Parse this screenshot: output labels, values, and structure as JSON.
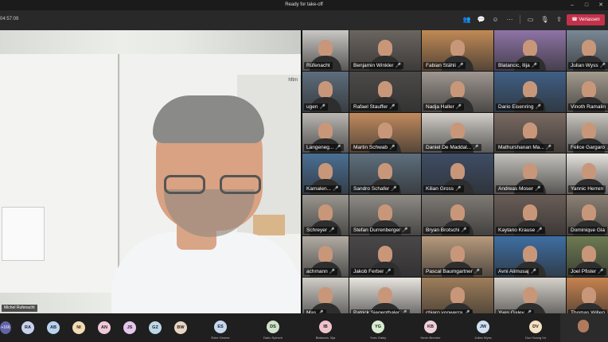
{
  "window": {
    "title": "Ready for take-off",
    "controls": [
      "–",
      "□",
      "✕"
    ]
  },
  "toolbar": {
    "timer": "04:57:09",
    "icons": [
      "people-icon",
      "chat-icon",
      "reactions-icon",
      "more-icon",
      "camera-icon",
      "mic-icon",
      "share-icon"
    ],
    "leave_label": "Verlassen"
  },
  "speaker": {
    "name": "Michel Rufenacht",
    "poster_logo": "hftm"
  },
  "participants": [
    {
      "name": "Rüfenacht",
      "bg": "#c9c7c4",
      "mic": false
    },
    {
      "name": "Benjamin Winkler",
      "bg": "#6b6560",
      "mic": true
    },
    {
      "name": "Fabian Stähli",
      "bg": "#c08a55",
      "mic": true
    },
    {
      "name": "Blatancic, Ilija",
      "bg": "#8e74a6",
      "mic": true
    },
    {
      "name": "Julian Wyss",
      "bg": "#7a8895",
      "mic": true
    },
    {
      "name": "ugen",
      "bg": "#5d6d7c",
      "mic": true
    },
    {
      "name": "Rafael Stauffer",
      "bg": "#4c4a49",
      "mic": true
    },
    {
      "name": "Nadja Haller",
      "bg": "#9e9690",
      "mic": true
    },
    {
      "name": "Dario Eisenring",
      "bg": "#3f5f85",
      "mic": true
    },
    {
      "name": "Vinoth Ramalin",
      "bg": "#a39b8e",
      "mic": true
    },
    {
      "name": "Langeneg...",
      "bg": "#b9b6b2",
      "mic": true
    },
    {
      "name": "Martin Schwab",
      "bg": "#c18a5d",
      "mic": true
    },
    {
      "name": "Daniel De Maddal...",
      "bg": "#d2cec8",
      "mic": true
    },
    {
      "name": "Mathurshanan Ma...",
      "bg": "#7a6a62",
      "mic": true
    },
    {
      "name": "Felice Gargaro",
      "bg": "#c9c5bf",
      "mic": true
    },
    {
      "name": "Kamalen...",
      "bg": "#4a6f94",
      "mic": true
    },
    {
      "name": "Sandro Schafer",
      "bg": "#5e6f7e",
      "mic": true
    },
    {
      "name": "Kilian Gross",
      "bg": "#3e4d66",
      "mic": true
    },
    {
      "name": "Andreas Moser",
      "bg": "#c4c1bb",
      "mic": true
    },
    {
      "name": "Yannic Herren",
      "bg": "#e6e3de",
      "mic": false
    },
    {
      "name": "Schreyer",
      "bg": "#9a968f",
      "mic": true
    },
    {
      "name": "Stefan Durrenberger",
      "bg": "#8f8c86",
      "mic": true
    },
    {
      "name": "Bryan Brotschi",
      "bg": "#7f7a74",
      "mic": true
    },
    {
      "name": "Kaytano Krause",
      "bg": "#6a5d57",
      "mic": true
    },
    {
      "name": "Dominique Gla",
      "bg": "#8c8175",
      "mic": false
    },
    {
      "name": "achmann",
      "bg": "#b1aba3",
      "mic": true
    },
    {
      "name": "Jakob Ferber",
      "bg": "#4a4748",
      "mic": true
    },
    {
      "name": "Pascal Baumgartner",
      "bg": "#b79a7c",
      "mic": true
    },
    {
      "name": "Avni Alimusaj",
      "bg": "#3e6ea2",
      "mic": true
    },
    {
      "name": "Joel Pfister",
      "bg": "#6d7a52",
      "mic": true
    },
    {
      "name": "Mas",
      "bg": "#d0ccc6",
      "mic": true
    },
    {
      "name": "Patrick Siegenthaler",
      "bg": "#e8e4df",
      "mic": true
    },
    {
      "name": "chiaro vonwerra",
      "bg": "#9f7e5a",
      "mic": true
    },
    {
      "name": "Yves Galey",
      "bg": "#d6d1ca",
      "mic": true
    },
    {
      "name": "Thomas Willen",
      "bg": "#c7834f",
      "mic": false
    }
  ],
  "bottom_bar": {
    "more_count": "+166",
    "avatars": [
      {
        "initials": "RA",
        "color": "#c7d2f0"
      },
      {
        "initials": "AB",
        "color": "#b9d3ef"
      },
      {
        "initials": "NI",
        "color": "#f2dcb3"
      },
      {
        "initials": "AN",
        "color": "#f0c8d8"
      },
      {
        "initials": "JS",
        "color": "#e7c6ec"
      },
      {
        "initials": "GZ",
        "color": "#bcd8e8"
      },
      {
        "initials": "BW",
        "color": "#ead5c2"
      }
    ],
    "named": [
      {
        "initials": "ES",
        "name": "Ésire Gemez",
        "color": "#c5d8f0"
      },
      {
        "initials": "DS",
        "name": "Dario Spirsch",
        "color": "#cfe3c8"
      },
      {
        "initials": "IB",
        "name": "Blatancic, Ilija",
        "color": "#f0c3cc"
      },
      {
        "initials": "YG",
        "name": "Yves Galey",
        "color": "#d8ecd0"
      },
      {
        "initials": "KB",
        "name": "Kevin Brecher",
        "color": "#f1cfd9"
      },
      {
        "initials": "JW",
        "name": "Julian Wyss",
        "color": "#cfe0f2"
      },
      {
        "initials": "DV",
        "name": "Duc Hoang Vu",
        "color": "#f4e2c2"
      }
    ]
  }
}
